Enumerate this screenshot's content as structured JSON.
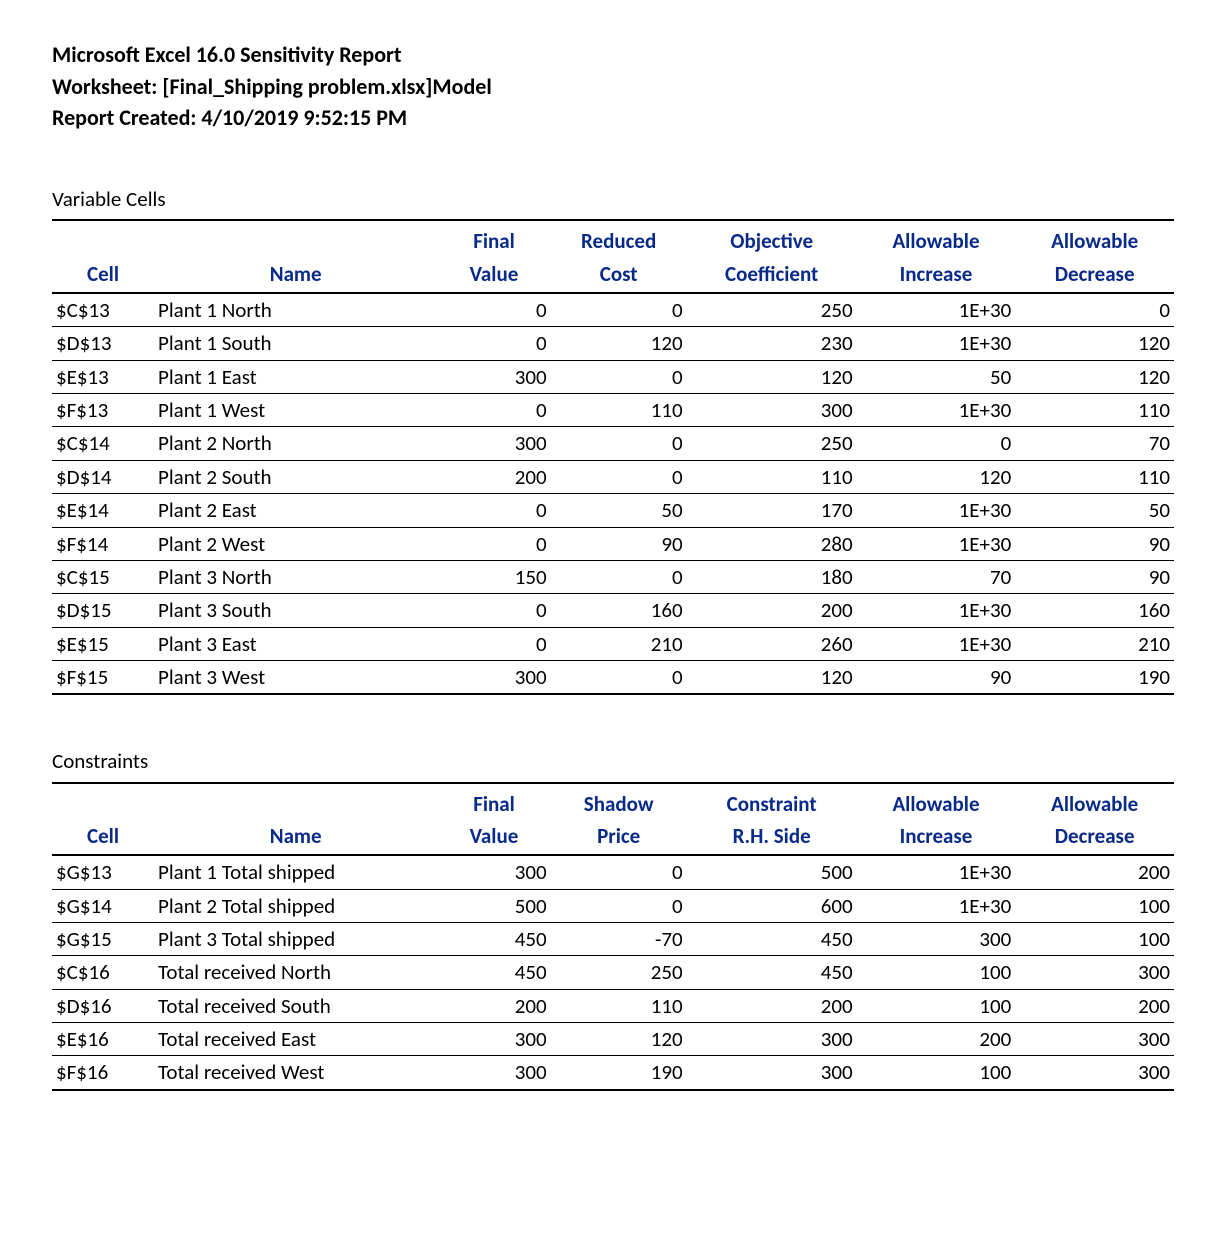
{
  "header": {
    "line1": "Microsoft Excel 16.0 Sensitivity Report",
    "line2": "Worksheet: [Final_Shipping problem.xlsx]Model",
    "line3": "Report Created: 4/10/2019 9:52:15 PM"
  },
  "sections": {
    "variable_cells": {
      "title": "Variable Cells",
      "headers_top": [
        "",
        "",
        "Final",
        "Reduced",
        "Objective",
        "Allowable",
        "Allowable"
      ],
      "headers_bottom": [
        "Cell",
        "Name",
        "Value",
        "Cost",
        "Coefficient",
        "Increase",
        "Decrease"
      ],
      "rows": [
        {
          "cell": "$C$13",
          "name": "Plant 1 North",
          "v1": "0",
          "v2": "0",
          "v3": "250",
          "v4": "1E+30",
          "v5": "0"
        },
        {
          "cell": "$D$13",
          "name": "Plant 1 South",
          "v1": "0",
          "v2": "120",
          "v3": "230",
          "v4": "1E+30",
          "v5": "120"
        },
        {
          "cell": "$E$13",
          "name": "Plant 1 East",
          "v1": "300",
          "v2": "0",
          "v3": "120",
          "v4": "50",
          "v5": "120"
        },
        {
          "cell": "$F$13",
          "name": "Plant 1 West",
          "v1": "0",
          "v2": "110",
          "v3": "300",
          "v4": "1E+30",
          "v5": "110"
        },
        {
          "cell": "$C$14",
          "name": "Plant 2 North",
          "v1": "300",
          "v2": "0",
          "v3": "250",
          "v4": "0",
          "v5": "70"
        },
        {
          "cell": "$D$14",
          "name": "Plant 2 South",
          "v1": "200",
          "v2": "0",
          "v3": "110",
          "v4": "120",
          "v5": "110"
        },
        {
          "cell": "$E$14",
          "name": "Plant 2 East",
          "v1": "0",
          "v2": "50",
          "v3": "170",
          "v4": "1E+30",
          "v5": "50"
        },
        {
          "cell": "$F$14",
          "name": "Plant 2 West",
          "v1": "0",
          "v2": "90",
          "v3": "280",
          "v4": "1E+30",
          "v5": "90"
        },
        {
          "cell": "$C$15",
          "name": "Plant 3 North",
          "v1": "150",
          "v2": "0",
          "v3": "180",
          "v4": "70",
          "v5": "90"
        },
        {
          "cell": "$D$15",
          "name": "Plant 3 South",
          "v1": "0",
          "v2": "160",
          "v3": "200",
          "v4": "1E+30",
          "v5": "160"
        },
        {
          "cell": "$E$15",
          "name": "Plant 3 East",
          "v1": "0",
          "v2": "210",
          "v3": "260",
          "v4": "1E+30",
          "v5": "210"
        },
        {
          "cell": "$F$15",
          "name": "Plant 3 West",
          "v1": "300",
          "v2": "0",
          "v3": "120",
          "v4": "90",
          "v5": "190"
        }
      ]
    },
    "constraints": {
      "title": "Constraints",
      "headers_top": [
        "",
        "",
        "Final",
        "Shadow",
        "Constraint",
        "Allowable",
        "Allowable"
      ],
      "headers_bottom": [
        "Cell",
        "Name",
        "Value",
        "Price",
        "R.H. Side",
        "Increase",
        "Decrease"
      ],
      "rows": [
        {
          "cell": "$G$13",
          "name": "Plant 1 Total shipped",
          "v1": "300",
          "v2": "0",
          "v3": "500",
          "v4": "1E+30",
          "v5": "200"
        },
        {
          "cell": "$G$14",
          "name": "Plant 2 Total shipped",
          "v1": "500",
          "v2": "0",
          "v3": "600",
          "v4": "1E+30",
          "v5": "100"
        },
        {
          "cell": "$G$15",
          "name": "Plant 3 Total shipped",
          "v1": "450",
          "v2": "-70",
          "v3": "450",
          "v4": "300",
          "v5": "100"
        },
        {
          "cell": "$C$16",
          "name": "Total received North",
          "v1": "450",
          "v2": "250",
          "v3": "450",
          "v4": "100",
          "v5": "300"
        },
        {
          "cell": "$D$16",
          "name": "Total received South",
          "v1": "200",
          "v2": "110",
          "v3": "200",
          "v4": "100",
          "v5": "200"
        },
        {
          "cell": "$E$16",
          "name": "Total received East",
          "v1": "300",
          "v2": "120",
          "v3": "300",
          "v4": "200",
          "v5": "300"
        },
        {
          "cell": "$F$16",
          "name": "Total received West",
          "v1": "300",
          "v2": "190",
          "v3": "300",
          "v4": "100",
          "v5": "300"
        }
      ]
    }
  }
}
